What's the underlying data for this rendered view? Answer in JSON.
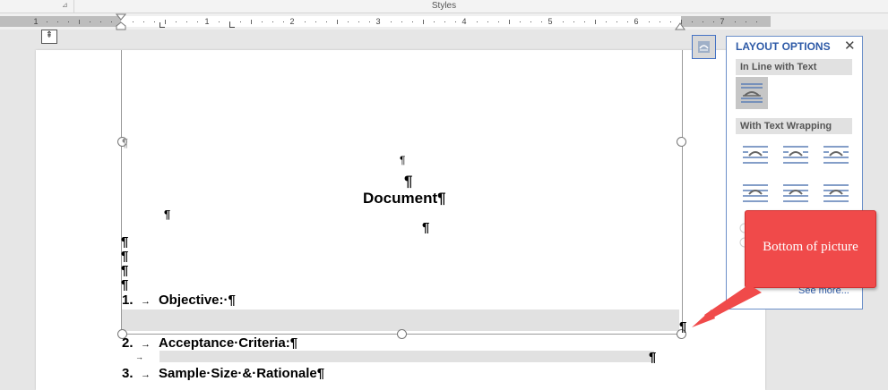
{
  "ribbon": {
    "styles_label": "Styles",
    "launcher_glyph": "⊿"
  },
  "ruler": {
    "numbers": [
      "1",
      "1",
      "2",
      "3",
      "4",
      "5",
      "6",
      "7"
    ]
  },
  "vruler_button_glyph": "⇞",
  "document": {
    "pilcrow": "¶",
    "title": "Document¶",
    "items": [
      {
        "number": "1.",
        "text": "Objective:·¶"
      },
      {
        "number": "2.",
        "text": "Acceptance·Criteria:¶"
      },
      {
        "number": "3.",
        "text": "Sample·Size·&·Rationale¶"
      }
    ],
    "tab_arrow": "→"
  },
  "layout_options": {
    "title": "LAYOUT OPTIONS",
    "close": "✕",
    "section_inline": "In Line with Text",
    "section_wrapping": "With Text Wrapping",
    "see_more": "See more...",
    "wrapping_icons": [
      "square-wrap-icon",
      "tight-wrap-icon",
      "through-wrap-icon",
      "top-bottom-wrap-icon",
      "behind-text-icon",
      "in-front-of-text-icon"
    ]
  },
  "callout": {
    "text": "Bottom of picture",
    "color": "#f04a4a"
  },
  "colors": {
    "accent": "#2e5aa7",
    "selection_border": "#4472c4"
  }
}
